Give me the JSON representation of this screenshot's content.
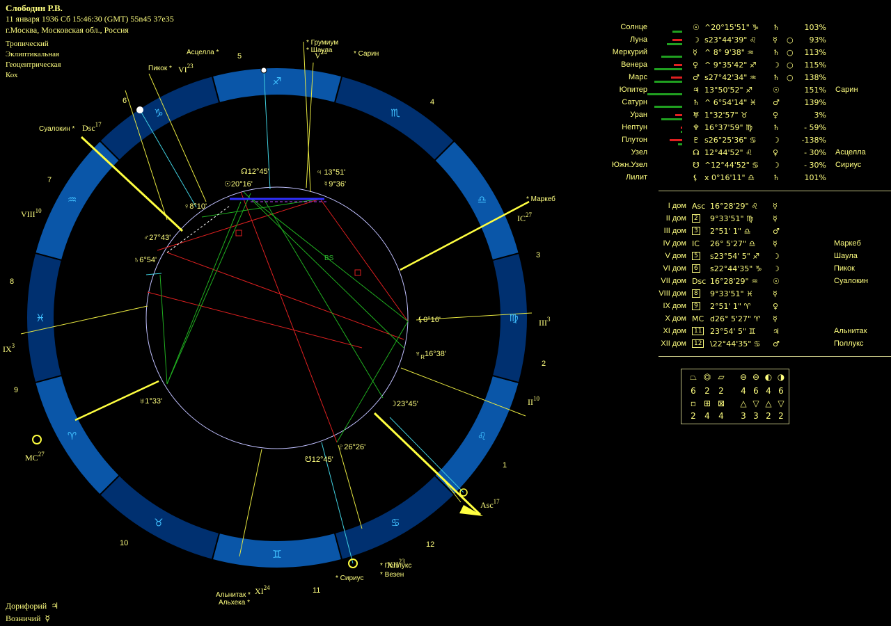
{
  "header": {
    "name": "Слободин Р.В.",
    "date_line": "11 января 1936  Сб  15:46:30 (GMT) 55n45  37e35",
    "place": "г.Москва, Московская обл., Россия",
    "zodiac": "Тропический",
    "coord": "Эклиптикальная",
    "center": "Геоцентрическая",
    "houses": "Кох"
  },
  "footer": {
    "line1": "Дорифорий",
    "line1_glyph": "♃",
    "line2": "Возничий",
    "line2_glyph": "☿"
  },
  "wheel": {
    "house_numbers": [
      "1",
      "2",
      "3",
      "4",
      "5",
      "6",
      "7",
      "8",
      "9",
      "10",
      "11",
      "12"
    ],
    "cusp_labels": {
      "asc": "Asc",
      "asc_deg": "17",
      "dsc": "Dsc",
      "dsc_deg": "17",
      "mc": "MC",
      "mc_deg": "27",
      "ic": "IC",
      "ic_deg": "27",
      "ii": "II",
      "ii_deg": "10",
      "iii": "III",
      "iii_deg": "3",
      "v": "V",
      "v_deg": "24",
      "vi": "VI",
      "vi_deg": "23",
      "viii": "VIII",
      "viii_deg": "10",
      "ix": "IX",
      "ix_deg": "3",
      "xi": "XI",
      "xi_deg": "24",
      "xii": "XII",
      "xii_deg": "23"
    },
    "stars": {
      "grumium": "Грумиум",
      "shaula": "Шаула",
      "sarin": "Сарин",
      "ascella": "Асцелла",
      "pikok": "Пикок",
      "sualokin": "Суалокин",
      "markeb": "Маркеб",
      "sirius": "Сириус",
      "pollux": "Поллукс",
      "vezen": "Везен",
      "alnitak": "Альнитак",
      "alheka": "Альхека"
    },
    "planet_labels": {
      "node": "12°45'",
      "jupiter": "13°51'",
      "sun": "20°16'",
      "mercury": "9°36'",
      "venus": "8°10'",
      "mars": "27°43'",
      "saturn": "6°54'",
      "lilith": "0°16'",
      "neptune": "16°38'",
      "moon": "23°45'",
      "pluto": "26°26'",
      "south_node": "12°45'",
      "uranus": "1°33'",
      "bs": "BS"
    }
  },
  "planets": [
    {
      "name": "Солнце",
      "glyph": "☉",
      "pos": "^20°15'51\"",
      "sign": "♑",
      "ruler": "♄",
      "ex": "",
      "pct": "103%",
      "star": "",
      "bar_g": 14,
      "bar_r": 0
    },
    {
      "name": "Луна",
      "glyph": "☽",
      "pos": "ꜱ23°44'39\"",
      "sign": "♌",
      "ruler": "☿",
      "ex": "○",
      "pct": "93%",
      "star": "",
      "bar_g": 22,
      "bar_r": 14
    },
    {
      "name": "Меркурий",
      "glyph": "☿",
      "pos": "^ 8° 9'38\"",
      "sign": "♒",
      "ruler": "♄",
      "ex": "○",
      "pct": "113%",
      "star": "",
      "bar_g": 30,
      "bar_r": 0
    },
    {
      "name": "Венера",
      "glyph": "♀",
      "pos": "^ 9°35'42\"",
      "sign": "♐",
      "ruler": "☽",
      "ex": "○",
      "pct": "115%",
      "star": "",
      "bar_g": 40,
      "bar_r": 12
    },
    {
      "name": "Марс",
      "glyph": "♂",
      "pos": "ꜱ27°42'34\"",
      "sign": "♒",
      "ruler": "♄",
      "ex": "○",
      "pct": "138%",
      "star": "",
      "bar_g": 40,
      "bar_r": 16
    },
    {
      "name": "Юпитер",
      "glyph": "♃",
      "pos": "13°50'52\"",
      "sign": "♐",
      "ruler": "☉",
      "ex": "",
      "pct": "151%",
      "star": "Сарин",
      "bar_g": 50,
      "bar_r": 0
    },
    {
      "name": "Сатурн",
      "glyph": "♄",
      "pos": "^ 6°54'14\"",
      "sign": "♓",
      "ruler": "♂",
      "ex": "",
      "pct": "139%",
      "star": "",
      "bar_g": 40,
      "bar_r": 0
    },
    {
      "name": "Уран",
      "glyph": "♅",
      "pos": "1°32'57\"",
      "sign": "♉",
      "ruler": "♀",
      "ex": "",
      "pct": "3%",
      "star": "",
      "bar_g": 30,
      "bar_r": 10
    },
    {
      "name": "Нептун",
      "glyph": "♆",
      "pos": "16°37'59\"",
      "sign": "♍",
      "ruler": "♄",
      "ex": "",
      "pct": "- 59%",
      "star": "",
      "bar_g": 2,
      "bar_r": 2
    },
    {
      "name": "Плутон",
      "glyph": "♇",
      "pos": "ꜱ26°25'36\"",
      "sign": "♋",
      "ruler": "☽",
      "ex": "",
      "pct": "-138%",
      "star": "",
      "bar_g": 6,
      "bar_r": 18
    },
    {
      "name": "Узел",
      "glyph": "☊",
      "pos": "12°44'52\"",
      "sign": "♌",
      "ruler": "♀",
      "ex": "",
      "pct": "- 30%",
      "star": "Асцелла",
      "bar_g": 0,
      "bar_r": 0
    },
    {
      "name": "Южн.Узел",
      "glyph": "☋",
      "pos": "^12°44'52\"",
      "sign": "♋",
      "ruler": "☽",
      "ex": "",
      "pct": "- 30%",
      "star": "Сириус",
      "bar_g": 0,
      "bar_r": 0
    },
    {
      "name": "Лилит",
      "glyph": "⚸",
      "pos": "x  0°16'11\"",
      "sign": "♎",
      "ruler": "♄",
      "ex": "",
      "pct": "101%",
      "star": "",
      "bar_g": 0,
      "bar_r": 0
    }
  ],
  "houses_table": [
    {
      "name": "I дом",
      "glyph": "Asc",
      "pos": "16°28'29\"",
      "sign": "♌",
      "ruler": "☿",
      "star": ""
    },
    {
      "name": "II дом",
      "glyph": "2",
      "pos": " 9°33'51\"",
      "sign": "♍",
      "ruler": "☿",
      "star": ""
    },
    {
      "name": "III дом",
      "glyph": "3",
      "pos": " 2°51' 1\"",
      "sign": "♎",
      "ruler": "♂",
      "star": ""
    },
    {
      "name": "IV дом",
      "glyph": "IC",
      "pos": "26° 5'27\"",
      "sign": "♎",
      "ruler": "☿",
      "star": "Маркеб"
    },
    {
      "name": "V дом",
      "glyph": "5",
      "pos": "ꜱ23°54' 5\"",
      "sign": "♐",
      "ruler": "☽",
      "star": "Шаула"
    },
    {
      "name": "VI дом",
      "glyph": "6",
      "pos": "ꜱ22°44'35\"",
      "sign": "♑",
      "ruler": "☽",
      "star": "Пикок"
    },
    {
      "name": "VII дом",
      "glyph": "Dsc",
      "pos": "16°28'29\"",
      "sign": "♒",
      "ruler": "☉",
      "star": "Суалокин"
    },
    {
      "name": "VIII дом",
      "glyph": "8",
      "pos": " 9°33'51\"",
      "sign": "♓",
      "ruler": "☿",
      "star": ""
    },
    {
      "name": "IX дом",
      "glyph": "9",
      "pos": " 2°51' 1\"",
      "sign": "♈",
      "ruler": "♀",
      "star": ""
    },
    {
      "name": "X дом",
      "glyph": "MC",
      "pos": "d26° 5'27\"",
      "sign": "♈",
      "ruler": "☿",
      "star": ""
    },
    {
      "name": "XI дом",
      "glyph": "11",
      "pos": "23°54' 5\"",
      "sign": "♊",
      "ruler": "♃",
      "star": "Альнитак"
    },
    {
      "name": "XII дом",
      "glyph": "12",
      "pos": "\\22°44'35\"",
      "sign": "♋",
      "ruler": "♂",
      "star": "Поллукс"
    }
  ],
  "elements": {
    "mod_glyphs": [
      "⏢",
      "⏣",
      "⏥"
    ],
    "mod_values": [
      "6",
      "2",
      "2"
    ],
    "phase_glyphs": [
      "⊖",
      "⊖",
      "◐",
      "◑"
    ],
    "phase_values": [
      "4",
      "6",
      "4",
      "6"
    ],
    "q_glyphs": [
      "▫",
      "⊞",
      "⊠"
    ],
    "q_values": [
      "2",
      "4",
      "4"
    ],
    "el_glyphs": [
      "△",
      "▽",
      "△",
      "▽"
    ],
    "el_values": [
      "3",
      "3",
      "2",
      "2"
    ]
  }
}
